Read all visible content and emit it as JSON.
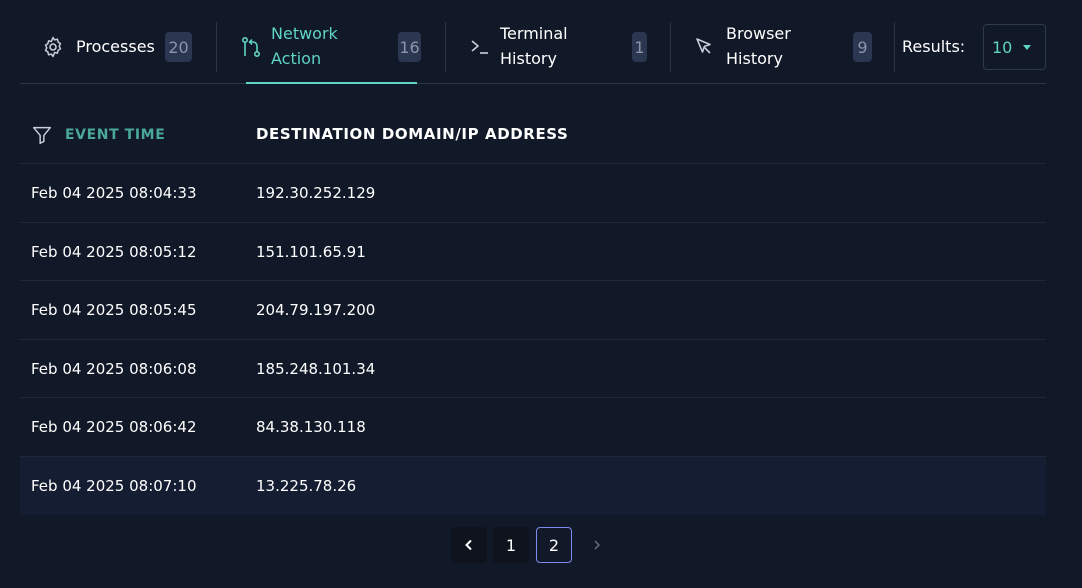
{
  "tabs": [
    {
      "line1": "Processes",
      "line2": "",
      "count": "20",
      "icon": "gear-icon"
    },
    {
      "line1": "Network",
      "line2": "Action",
      "count": "16",
      "icon": "git-branch-icon"
    },
    {
      "line1": "Terminal",
      "line2": "History",
      "count": "1",
      "icon": "terminal-icon"
    },
    {
      "line1": "Browser",
      "line2": "History",
      "count": "9",
      "icon": "cursor-icon"
    }
  ],
  "active_tab": "Network Action",
  "results": {
    "label": "Results:",
    "value": "10"
  },
  "table": {
    "columns": [
      "EVENT TIME",
      "DESTINATION DOMAIN/IP ADDRESS"
    ],
    "rows": [
      [
        "Feb 04 2025 08:04:33",
        "192.30.252.129"
      ],
      [
        "Feb 04 2025 08:05:12",
        "151.101.65.91"
      ],
      [
        "Feb 04 2025 08:05:45",
        "204.79.197.200"
      ],
      [
        "Feb 04 2025 08:06:08",
        "185.248.101.34"
      ],
      [
        "Feb 04 2025 08:06:42",
        "84.38.130.118"
      ],
      [
        "Feb 04 2025 08:07:10",
        "13.225.78.26"
      ]
    ]
  },
  "pagination": {
    "pages": [
      "1",
      "2"
    ],
    "current": "2"
  },
  "colors": {
    "accent": "#5ed4c4",
    "background": "#111827",
    "badge": "#2b3650",
    "current_page_border": "#7c8cf0"
  }
}
